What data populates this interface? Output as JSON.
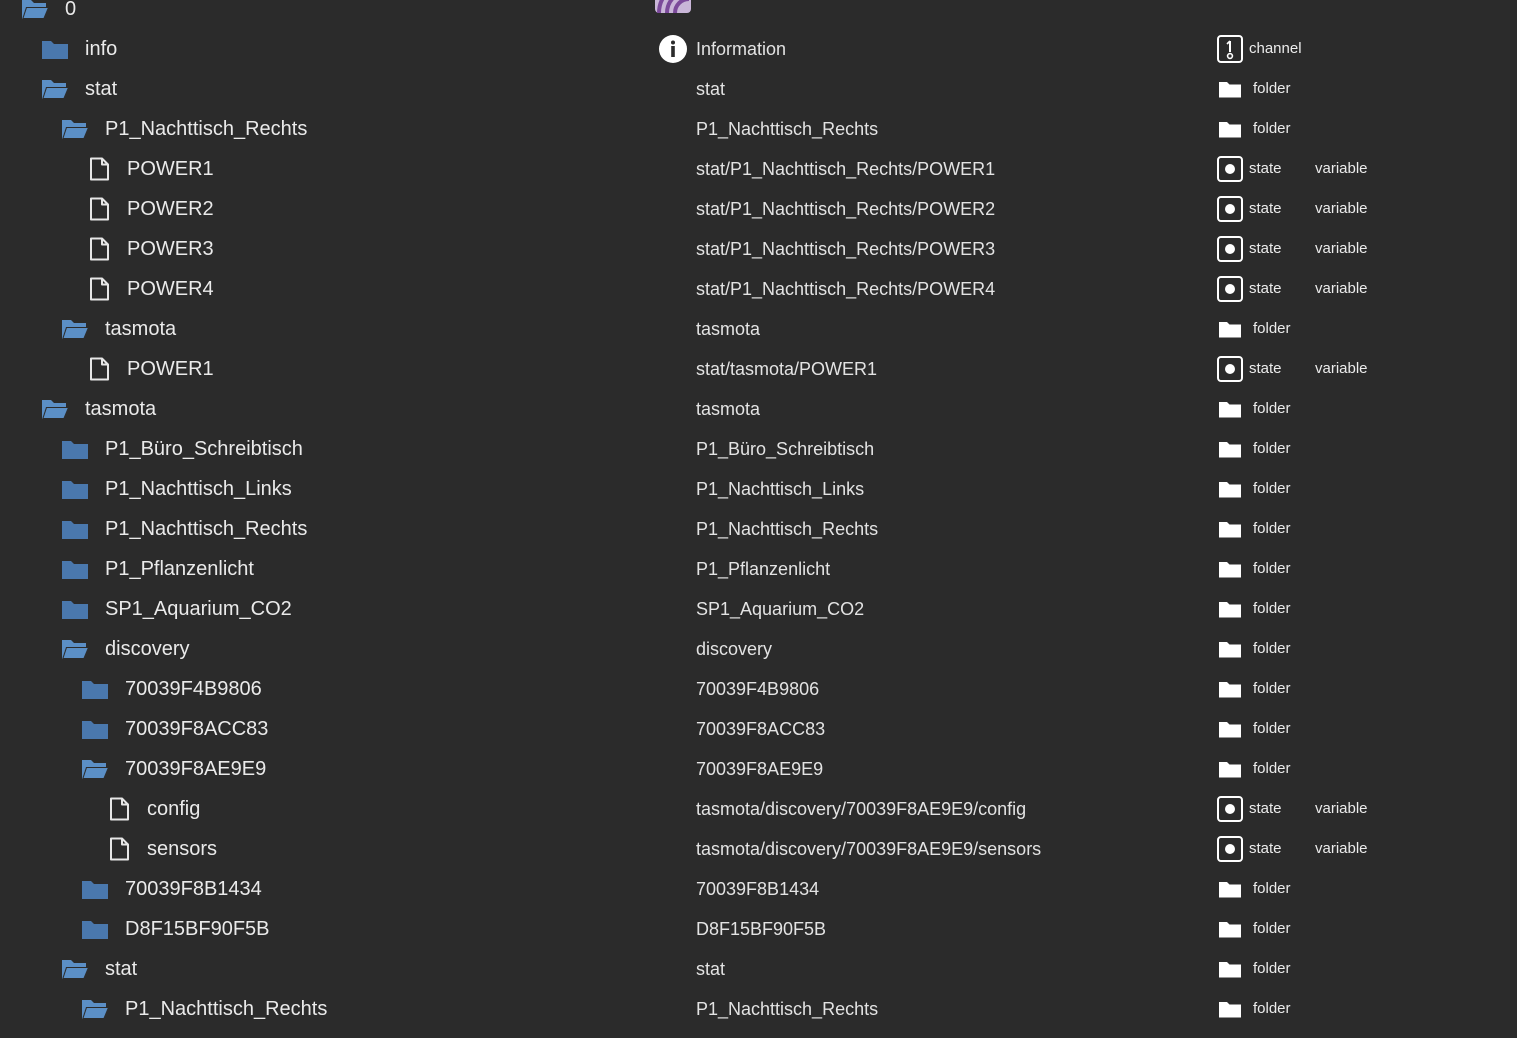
{
  "colors": {
    "background": "#2b2b2b",
    "folder_closed": "#4a78ad",
    "folder_open": "#5b8fc6",
    "text": "#eaeaea"
  },
  "rows": [
    {
      "name": "0",
      "level": 0,
      "icon": "folder-open-icon",
      "desc": "",
      "type": "",
      "role": ""
    },
    {
      "name": "info",
      "level": 1,
      "icon": "folder-closed-icon",
      "desc": "Information",
      "type": "channel",
      "role": ""
    },
    {
      "name": "stat",
      "level": 1,
      "icon": "folder-open-icon",
      "desc": "stat",
      "type": "folder",
      "role": ""
    },
    {
      "name": "P1_Nachttisch_Rechts",
      "level": 2,
      "icon": "folder-open-icon",
      "desc": "P1_Nachttisch_Rechts",
      "type": "folder",
      "role": ""
    },
    {
      "name": "POWER1",
      "level": 3,
      "icon": "file-icon",
      "desc": "stat/P1_Nachttisch_Rechts/POWER1",
      "type": "state",
      "role": "variable"
    },
    {
      "name": "POWER2",
      "level": 3,
      "icon": "file-icon",
      "desc": "stat/P1_Nachttisch_Rechts/POWER2",
      "type": "state",
      "role": "variable"
    },
    {
      "name": "POWER3",
      "level": 3,
      "icon": "file-icon",
      "desc": "stat/P1_Nachttisch_Rechts/POWER3",
      "type": "state",
      "role": "variable"
    },
    {
      "name": "POWER4",
      "level": 3,
      "icon": "file-icon",
      "desc": "stat/P1_Nachttisch_Rechts/POWER4",
      "type": "state",
      "role": "variable"
    },
    {
      "name": "tasmota",
      "level": 2,
      "icon": "folder-open-icon",
      "desc": "tasmota",
      "type": "folder",
      "role": ""
    },
    {
      "name": "POWER1",
      "level": 3,
      "icon": "file-icon",
      "desc": "stat/tasmota/POWER1",
      "type": "state",
      "role": "variable"
    },
    {
      "name": "tasmota",
      "level": 1,
      "icon": "folder-open-icon",
      "desc": "tasmota",
      "type": "folder",
      "role": ""
    },
    {
      "name": "P1_Büro_Schreibtisch",
      "level": 2,
      "icon": "folder-closed-icon",
      "desc": "P1_Büro_Schreibtisch",
      "type": "folder",
      "role": ""
    },
    {
      "name": "P1_Nachttisch_Links",
      "level": 2,
      "icon": "folder-closed-icon",
      "desc": "P1_Nachttisch_Links",
      "type": "folder",
      "role": ""
    },
    {
      "name": "P1_Nachttisch_Rechts",
      "level": 2,
      "icon": "folder-closed-icon",
      "desc": "P1_Nachttisch_Rechts",
      "type": "folder",
      "role": ""
    },
    {
      "name": "P1_Pflanzenlicht",
      "level": 2,
      "icon": "folder-closed-icon",
      "desc": "P1_Pflanzenlicht",
      "type": "folder",
      "role": ""
    },
    {
      "name": "SP1_Aquarium_CO2",
      "level": 2,
      "icon": "folder-closed-icon",
      "desc": "SP1_Aquarium_CO2",
      "type": "folder",
      "role": ""
    },
    {
      "name": "discovery",
      "level": 2,
      "icon": "folder-open-icon",
      "desc": "discovery",
      "type": "folder",
      "role": ""
    },
    {
      "name": "70039F4B9806",
      "level": 3,
      "icon": "folder-closed-icon",
      "desc": "70039F4B9806",
      "type": "folder",
      "role": ""
    },
    {
      "name": "70039F8ACC83",
      "level": 3,
      "icon": "folder-closed-icon",
      "desc": "70039F8ACC83",
      "type": "folder",
      "role": ""
    },
    {
      "name": "70039F8AE9E9",
      "level": 3,
      "icon": "folder-open-icon",
      "desc": "70039F8AE9E9",
      "type": "folder",
      "role": ""
    },
    {
      "name": "config",
      "level": 4,
      "icon": "file-icon",
      "desc": "tasmota/discovery/70039F8AE9E9/config",
      "type": "state",
      "role": "variable"
    },
    {
      "name": "sensors",
      "level": 4,
      "icon": "file-icon",
      "desc": "tasmota/discovery/70039F8AE9E9/sensors",
      "type": "state",
      "role": "variable"
    },
    {
      "name": "70039F8B1434",
      "level": 3,
      "icon": "folder-closed-icon",
      "desc": "70039F8B1434",
      "type": "folder",
      "role": ""
    },
    {
      "name": "D8F15BF90F5B",
      "level": 3,
      "icon": "folder-closed-icon",
      "desc": "D8F15BF90F5B",
      "type": "folder",
      "role": ""
    },
    {
      "name": "stat",
      "level": 2,
      "icon": "folder-open-icon",
      "desc": "stat",
      "type": "folder",
      "role": ""
    },
    {
      "name": "P1_Nachttisch_Rechts",
      "level": 3,
      "icon": "folder-open-icon",
      "desc": "P1_Nachttisch_Rechts",
      "type": "folder",
      "role": ""
    }
  ]
}
